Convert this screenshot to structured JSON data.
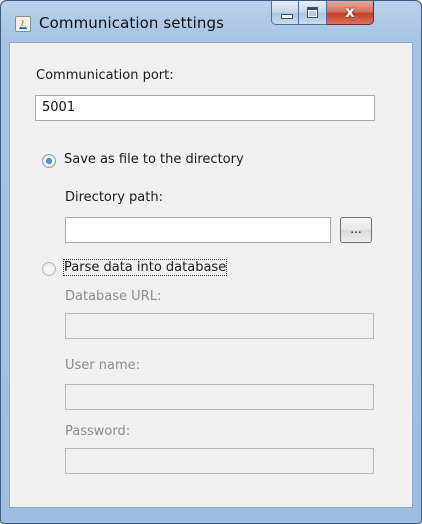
{
  "window": {
    "title": "Communication settings",
    "close_glyph": "x"
  },
  "port": {
    "label": "Communication port:",
    "value": "5001"
  },
  "save_option": {
    "label": "Save as file to the directory",
    "selected": true,
    "directory_label": "Directory path:",
    "directory_value": "",
    "browse_label": "..."
  },
  "db_option": {
    "label": "Parse data into database",
    "selected": false,
    "url_label": "Database URL:",
    "url_value": "",
    "user_label": "User name:",
    "user_value": "",
    "password_label": "Password:",
    "password_value": ""
  },
  "colors": {
    "frame": "#a7c3e3",
    "client_bg": "#f0f0f0",
    "close_button": "#c0402a",
    "radio_selected": "#1d5fb0",
    "disabled_text": "#8c8c8c"
  },
  "icons": [
    "java-app-icon",
    "minimize-icon",
    "maximize-icon",
    "close-icon"
  ]
}
